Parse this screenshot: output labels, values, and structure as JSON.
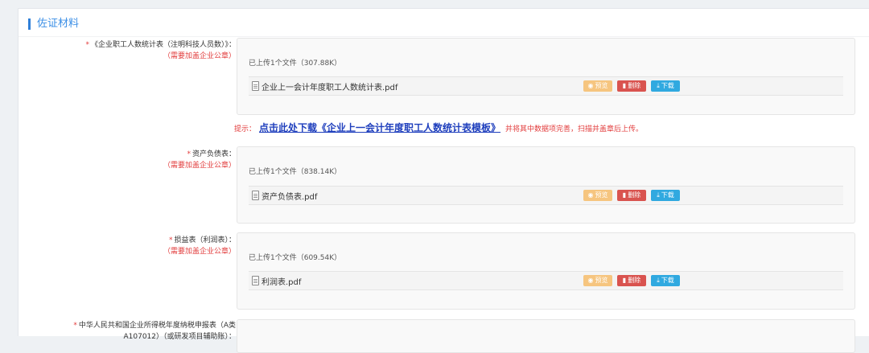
{
  "section": {
    "title": "佐证材料"
  },
  "items": [
    {
      "label": "《企业职工人数统计表（注明科技人员数）》：",
      "required_stamp": "（需要加盖企业公章）",
      "uploaded_text": "已上传1个文件（307.88K）",
      "file_name": "企业上一会计年度职工人数统计表.pdf"
    },
    {
      "label": "资产负债表：",
      "required_stamp": "（需要加盖企业公章）",
      "uploaded_text": "已上传1个文件（838.14K）",
      "file_name": "资产负债表.pdf"
    },
    {
      "label": "损益表（利润表）：",
      "required_stamp": "（需要加盖企业公章）",
      "uploaded_text": "已上传1个文件（609.54K）",
      "file_name": "利润表.pdf"
    },
    {
      "label": "中华人民共和国企业所得税年度纳税申报表（A类",
      "label_line2": "A107012）（或研发项目辅助账）："
    }
  ],
  "hint": {
    "label": "提示：",
    "link": "点击此处下载《企业上一会计年度职工人数统计表模板》",
    "after": "并将其中数据项完善，扫描并盖章后上传。"
  },
  "buttons": {
    "preview": "预览",
    "delete": "删除",
    "download": "下载"
  },
  "icons": {
    "preview": "eye-icon",
    "delete": "trash-icon",
    "download": "download-icon",
    "file": "file-icon"
  },
  "colors": {
    "accent": "#2f7fd8",
    "required": "#e23c3c",
    "link": "#1f3fbd",
    "preview_btn": "#f6c57f",
    "delete_btn": "#d9534f",
    "download_btn": "#30a9e0"
  }
}
